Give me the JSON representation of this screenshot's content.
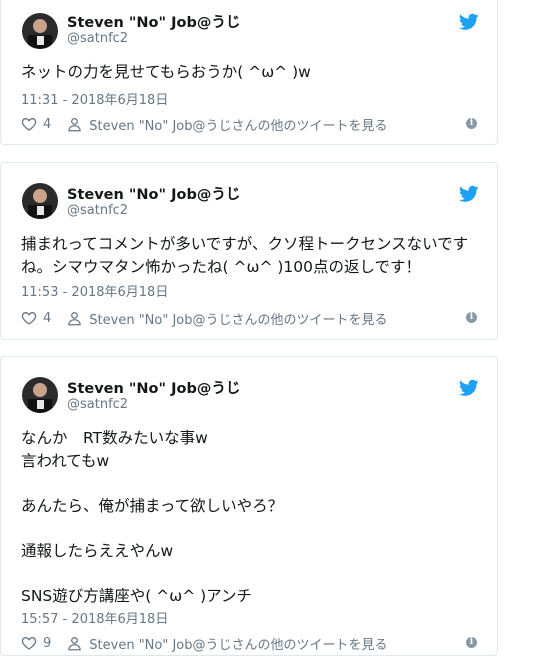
{
  "tweets": [
    {
      "name": "Steven \"No\" Job@うじ",
      "handle": "@satnfc2",
      "text": "ネットの力を見せてもらおうか( ^ω^ )w",
      "time": "11:31 - 2018年6月18日",
      "likes": "4",
      "more_link": "Steven \"No\" Job@うじさんの他のツイートを見る"
    },
    {
      "name": "Steven \"No\" Job@うじ",
      "handle": "@satnfc2",
      "text": "捕まれってコメントが多いですが、クソ程トークセンスないですね。シマウマタン怖かったね( ^ω^ )100点の返しです！",
      "time": "11:53 - 2018年6月18日",
      "likes": "4",
      "more_link": "Steven \"No\" Job@うじさんの他のツイートを見る"
    },
    {
      "name": "Steven \"No\" Job@うじ",
      "handle": "@satnfc2",
      "text": "なんか　RT数みたいな事w\n言われてもw\n\nあんたら、俺が捕まって欲しいやろ？\n\n通報したらええやんw\n\nSNS遊び方講座や( ^ω^ )アンチ",
      "time": "15:57 - 2018年6月18日",
      "likes": "9",
      "more_link": "Steven \"No\" Job@うじさんの他のツイートを見る"
    }
  ],
  "colors": {
    "accent": "#1da1f2",
    "muted": "#657786",
    "border": "#e1e8ed"
  },
  "icons": {
    "brand": "twitter-bird-icon",
    "like": "heart-icon",
    "profile": "person-icon",
    "info": "info-icon"
  }
}
